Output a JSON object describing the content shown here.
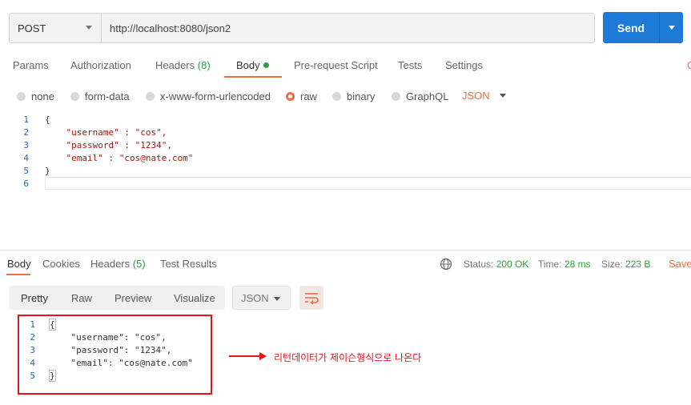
{
  "request": {
    "method": "POST",
    "url": "http://localhost:8080/json2",
    "send_label": "Send"
  },
  "request_tabs": {
    "params": "Params",
    "authorization": "Authorization",
    "headers": "Headers",
    "headers_count": "(8)",
    "body": "Body",
    "prerequest": "Pre-request Script",
    "tests": "Tests",
    "settings": "Settings",
    "cut_off": "C"
  },
  "body_types": {
    "none": "none",
    "form_data": "form-data",
    "urlencoded": "x-www-form-urlencoded",
    "raw": "raw",
    "binary": "binary",
    "graphql": "GraphQL",
    "format": "JSON",
    "selected": "raw"
  },
  "request_body": {
    "line_numbers": [
      "1",
      "2",
      "3",
      "4",
      "5",
      "6"
    ],
    "lines": [
      "{",
      "    \"username\" : \"cos\",",
      "    \"password\" : \"1234\",",
      "    \"email\" : \"cos@nate.com\"",
      "}",
      ""
    ]
  },
  "response_tabs": {
    "body": "Body",
    "cookies": "Cookies",
    "headers": "Headers",
    "headers_count": "(5)",
    "test_results": "Test Results"
  },
  "response_status": {
    "status_label": "Status:",
    "status_value": "200 OK",
    "time_label": "Time:",
    "time_value": "28 ms",
    "size_label": "Size:",
    "size_value": "223 B",
    "save_label": "Save"
  },
  "viewer": {
    "pretty": "Pretty",
    "raw": "Raw",
    "preview": "Preview",
    "visualize": "Visualize",
    "format": "JSON"
  },
  "response_body": {
    "line_numbers": [
      "1",
      "2",
      "3",
      "4",
      "5"
    ],
    "lines": [
      "{",
      "    \"username\": \"cos\",",
      "    \"password\": \"1234\",",
      "    \"email\": \"cos@nate.com\"",
      "}"
    ]
  },
  "annotation": {
    "text": "리턴데이터가 제이슨형식으로 나온다",
    "color": "#e8121b"
  },
  "colors": {
    "accent": "#f26b3a",
    "send": "#1d7ad7",
    "success": "#2e9e3a"
  }
}
